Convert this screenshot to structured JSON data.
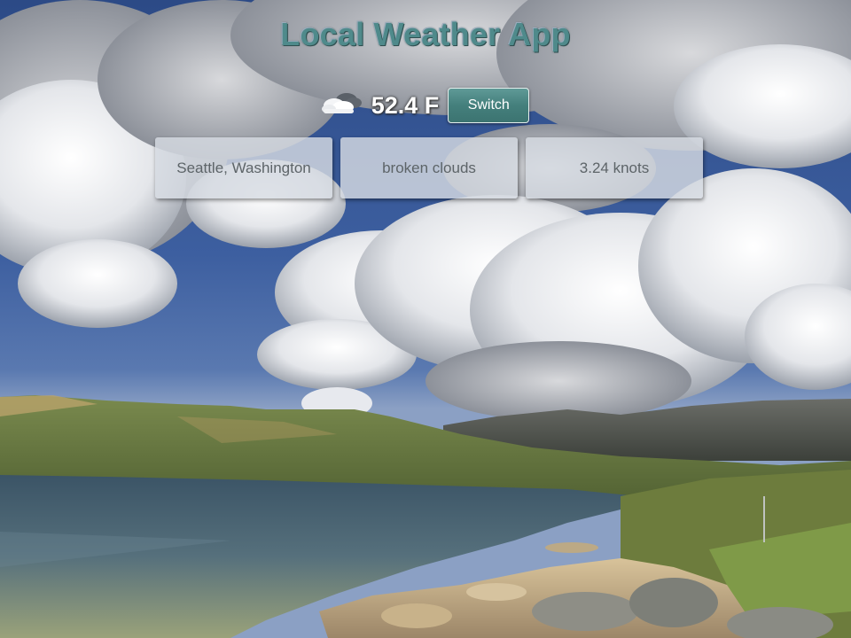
{
  "app": {
    "title": "Local Weather App"
  },
  "weather": {
    "icon": "broken-clouds-icon",
    "temperature": "52.4 F",
    "switch_label": "Switch"
  },
  "cards": {
    "location": "Seattle, Washington",
    "condition": "broken clouds",
    "wind": "3.24 knots"
  },
  "colors": {
    "title": "#4f8a8b",
    "button": "#447f7c",
    "card_bg": "#d6dae2",
    "card_text": "#5d6468"
  }
}
